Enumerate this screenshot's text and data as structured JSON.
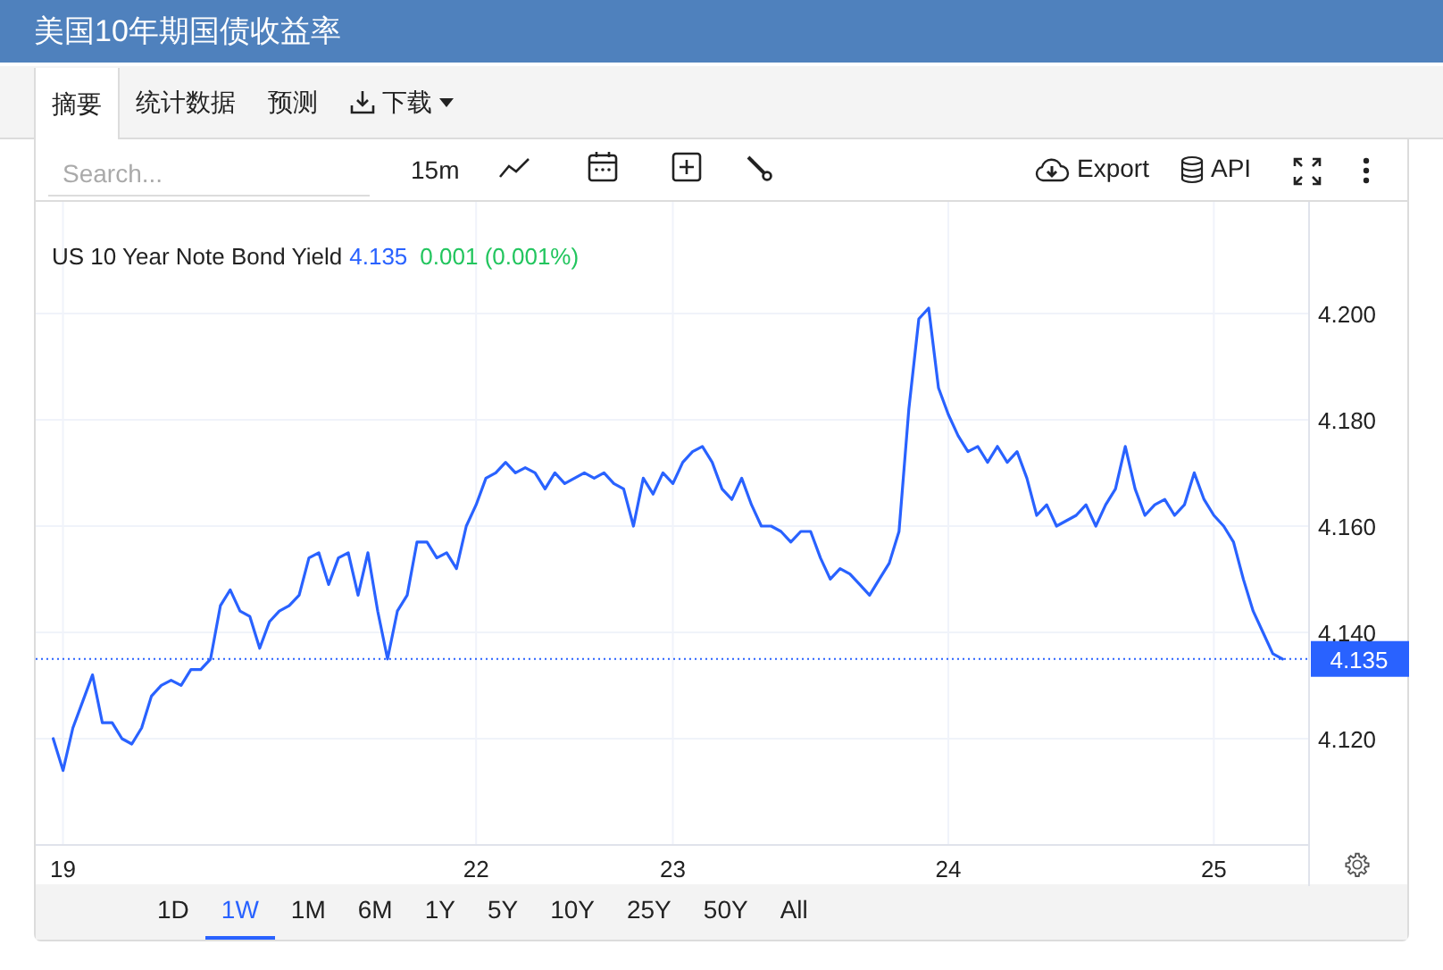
{
  "title": "美国10年期国债收益率",
  "tabs": [
    {
      "label": "摘要",
      "selected": true,
      "kind": "tab"
    },
    {
      "label": "统计数据",
      "selected": false,
      "kind": "tab"
    },
    {
      "label": "预测",
      "selected": false,
      "kind": "tab"
    },
    {
      "label": "下载",
      "selected": false,
      "kind": "menu"
    }
  ],
  "toolbar": {
    "search": {
      "placeholder": "Search..."
    },
    "interval": "15m",
    "export": "Export",
    "api": "API"
  },
  "legend": {
    "name": "US 10 Year Note Bond Yield",
    "value": "4.135",
    "change": "0.001 (0.001%)"
  },
  "price_label": "4.135",
  "chart_data": {
    "type": "line",
    "grid": true,
    "ref_lines": [
      {
        "axis": "y",
        "value": 4.135
      }
    ],
    "categories": [
      null,
      "19",
      null,
      null,
      null,
      null,
      null,
      null,
      null,
      null,
      null,
      null,
      null,
      null,
      null,
      null,
      null,
      null,
      null,
      null,
      null,
      null,
      null,
      null,
      null,
      null,
      null,
      null,
      null,
      null,
      null,
      null,
      null,
      null,
      null,
      null,
      null,
      null,
      null,
      null,
      null,
      null,
      null,
      "22",
      null,
      null,
      null,
      null,
      null,
      null,
      null,
      null,
      null,
      null,
      null,
      null,
      null,
      null,
      null,
      null,
      null,
      null,
      null,
      "23",
      null,
      null,
      null,
      null,
      null,
      null,
      null,
      null,
      null,
      null,
      null,
      null,
      null,
      null,
      null,
      null,
      null,
      null,
      null,
      null,
      null,
      null,
      null,
      null,
      null,
      null,
      null,
      "24",
      null,
      null,
      null,
      null,
      null,
      null,
      null,
      null,
      null,
      null,
      null,
      null,
      null,
      null,
      null,
      null,
      null,
      null,
      null,
      null,
      null,
      null,
      null,
      null,
      null,
      null,
      "25",
      null,
      null,
      null,
      null,
      null,
      null,
      null
    ],
    "ylim": [
      4.1,
      4.221
    ],
    "yticks": [
      {
        "value": 4.12,
        "label": "4.120"
      },
      {
        "value": 4.14,
        "label": "4.140"
      },
      {
        "value": 4.16,
        "label": "4.160"
      },
      {
        "value": 4.18,
        "label": "4.180"
      },
      {
        "value": 4.2,
        "label": "4.200"
      }
    ],
    "series": [
      {
        "color": "#2962ff",
        "values": [
          4.12,
          4.114,
          4.122,
          4.127,
          4.132,
          4.123,
          4.123,
          4.12,
          4.119,
          4.122,
          4.128,
          4.13,
          4.131,
          4.13,
          4.133,
          4.133,
          4.135,
          4.145,
          4.148,
          4.144,
          4.143,
          4.137,
          4.142,
          4.144,
          4.145,
          4.147,
          4.154,
          4.155,
          4.149,
          4.154,
          4.155,
          4.147,
          4.155,
          4.144,
          4.135,
          4.144,
          4.147,
          4.157,
          4.157,
          4.154,
          4.155,
          4.152,
          4.16,
          4.164,
          4.169,
          4.17,
          4.172,
          4.17,
          4.171,
          4.17,
          4.167,
          4.17,
          4.168,
          4.169,
          4.17,
          4.169,
          4.17,
          4.168,
          4.167,
          4.16,
          4.169,
          4.166,
          4.17,
          4.168,
          4.172,
          4.174,
          4.175,
          4.172,
          4.167,
          4.165,
          4.169,
          4.164,
          4.16,
          4.16,
          4.159,
          4.157,
          4.159,
          4.159,
          4.154,
          4.15,
          4.152,
          4.151,
          4.149,
          4.147,
          4.15,
          4.153,
          4.159,
          4.182,
          4.199,
          4.201,
          4.186,
          4.181,
          4.177,
          4.174,
          4.175,
          4.172,
          4.175,
          4.172,
          4.174,
          4.169,
          4.162,
          4.164,
          4.16,
          4.161,
          4.162,
          4.164,
          4.16,
          4.164,
          4.167,
          4.175,
          4.167,
          4.162,
          4.164,
          4.165,
          4.162,
          4.164,
          4.17,
          4.165,
          4.162,
          4.16,
          4.157,
          4.15,
          4.144,
          4.14,
          4.136,
          4.135
        ]
      }
    ]
  },
  "ranges": [
    {
      "label": "1D",
      "selected": false
    },
    {
      "label": "1W",
      "selected": true
    },
    {
      "label": "1M",
      "selected": false
    },
    {
      "label": "6M",
      "selected": false
    },
    {
      "label": "1Y",
      "selected": false
    },
    {
      "label": "5Y",
      "selected": false
    },
    {
      "label": "10Y",
      "selected": false
    },
    {
      "label": "25Y",
      "selected": false
    },
    {
      "label": "50Y",
      "selected": false
    },
    {
      "label": "All",
      "selected": false
    }
  ]
}
